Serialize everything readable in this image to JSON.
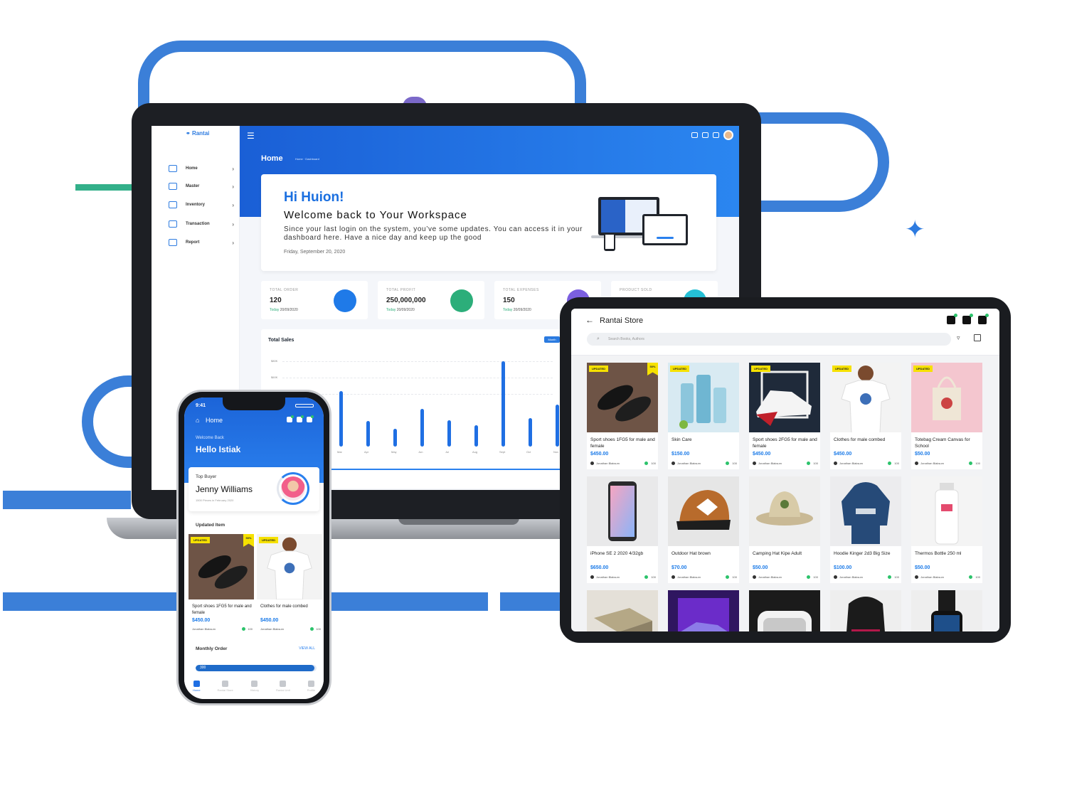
{
  "colors": {
    "brand_blue": "#1f6fe3",
    "accent_green": "#2cc36b",
    "badge_yellow": "#f6e100"
  },
  "laptop": {
    "logo": "Rantai",
    "sidebar": [
      {
        "label": "Home",
        "icon": "home-icon"
      },
      {
        "label": "Master",
        "icon": "folder-icon"
      },
      {
        "label": "Inventory",
        "icon": "box-icon"
      },
      {
        "label": "Transaction",
        "icon": "cart-icon"
      },
      {
        "label": "Report",
        "icon": "report-icon"
      }
    ],
    "page_title": "Home",
    "breadcrumb": "Home  ·  Dashboard",
    "welcome": {
      "greeting": "Hi Huion!",
      "headline": "Welcome back to Your Workspace",
      "message": "Since your last login on the system, you’ve some updates. You can access it in your dashboard here. Have a nice day and keep up the good",
      "date": "Friday, September 20, 2020"
    },
    "stats": [
      {
        "label": "TOTAL ORDER",
        "value": "120",
        "day": "Today",
        "date": "20/09/2020",
        "color": "#1f7ae8"
      },
      {
        "label": "TOTAL PROFIT",
        "value": "250,000,000",
        "day": "Today",
        "date": "20/09/2020",
        "color": "#2cae7a"
      },
      {
        "label": "TOTAL EXPENSES",
        "value": "150",
        "day": "Today",
        "date": "20/09/2020",
        "color": "#7b5fe0"
      },
      {
        "label": "PRODUCT SOLD",
        "value": "",
        "day": "",
        "date": "",
        "color": "#25c0d6"
      }
    ],
    "sales_title": "Total Sales",
    "sales_button": "Month"
  },
  "chart_data": {
    "type": "bar",
    "title": "Total Sales",
    "categories": [
      "Mar",
      "Apr",
      "May",
      "Jun",
      "Jul",
      "Aug",
      "Sept",
      "Oct",
      "Nov"
    ],
    "values": [
      105,
      48,
      33,
      72,
      50,
      40,
      162,
      54,
      80
    ],
    "y_ticks": [
      "$80K",
      "$60K",
      "$40K"
    ],
    "ylim": [
      0,
      175
    ]
  },
  "tablet": {
    "title": "Rantai Store",
    "search_placeholder": "Search Books, Authors",
    "products": [
      {
        "name": "Sport shoes 1FG5 for male and female",
        "price": "$450.00",
        "seller": "Jonathan Blaksum",
        "count": "100",
        "badge": "UPDATED",
        "discount": "50%",
        "img": "shoe"
      },
      {
        "name": "Skin Care",
        "price": "$150.00",
        "seller": "Jonathan Blaksum",
        "count": "100",
        "badge": "UPDATED",
        "discount": "",
        "img": "skincare"
      },
      {
        "name": "Sport shoes 2FG5 for male and female",
        "price": "$450.00",
        "seller": "Jonathan Blaksum",
        "count": "100",
        "badge": "UPDATED",
        "discount": "",
        "img": "sneaker"
      },
      {
        "name": "Clothes for male combed",
        "price": "$450.00",
        "seller": "Jonathan Blaksum",
        "count": "100",
        "badge": "UPDATED",
        "discount": "",
        "img": "tshirt"
      },
      {
        "name": "Totebag Cream Canvas for School",
        "price": "$50.00",
        "seller": "Jonathan Blaksum",
        "count": "100",
        "badge": "UPDATED",
        "discount": "",
        "img": "tote"
      },
      {
        "name": "iPhone SE 2 2020 4/32gb",
        "price": "$650.00",
        "seller": "Jonathan Blaksum",
        "count": "100",
        "badge": "",
        "discount": "",
        "img": "phone"
      },
      {
        "name": "Outdoor Hat brown",
        "price": "$70.00",
        "seller": "Jonathan Blaksum",
        "count": "100",
        "badge": "",
        "discount": "",
        "img": "cap"
      },
      {
        "name": "Camping Hat Kipe Adult",
        "price": "$50.00",
        "seller": "Jonathan Blaksum",
        "count": "100",
        "badge": "",
        "discount": "",
        "img": "bucket"
      },
      {
        "name": "Hoodie Kinger 2d3 Big Size",
        "price": "$100.00",
        "seller": "Jonathan Blaksum",
        "count": "100",
        "badge": "",
        "discount": "",
        "img": "hoodie"
      },
      {
        "name": "Thermos Bottle 250 ml",
        "price": "$50.00",
        "seller": "Jonathan Blaksum",
        "count": "100",
        "badge": "",
        "discount": "",
        "img": "bottle"
      }
    ]
  },
  "phone": {
    "time": "9:41",
    "header": "Home",
    "welcome": "Welcome Back",
    "user": "Hello Istiak",
    "top_buyer_label": "Top Buyer",
    "top_buyer_name": "Jenny Williams",
    "top_buyer_sub": "1500 Pieces in February 2020",
    "updated_item_label": "Updated Item",
    "items": [
      {
        "name": "Sport shoes 1FG5 for male and female",
        "price": "$450.00",
        "seller": "Jonathan Blaksum",
        "count": "100",
        "badge": "UPDATED",
        "discount": "50%",
        "img": "shoe"
      },
      {
        "name": "Clothes for male combed",
        "price": "$450.00",
        "seller": "Jonathan Blaksum",
        "count": "100",
        "badge": "UPDATED",
        "discount": "",
        "img": "tshirt"
      }
    ],
    "monthly_order_label": "Monthly Order",
    "view_all": "VIEW ALL",
    "monthly_value": "300",
    "monthly_fraction": 0.98,
    "tabs": [
      "Home",
      "Rantai Store",
      "History",
      "Rantai Unit",
      "Profile"
    ]
  }
}
